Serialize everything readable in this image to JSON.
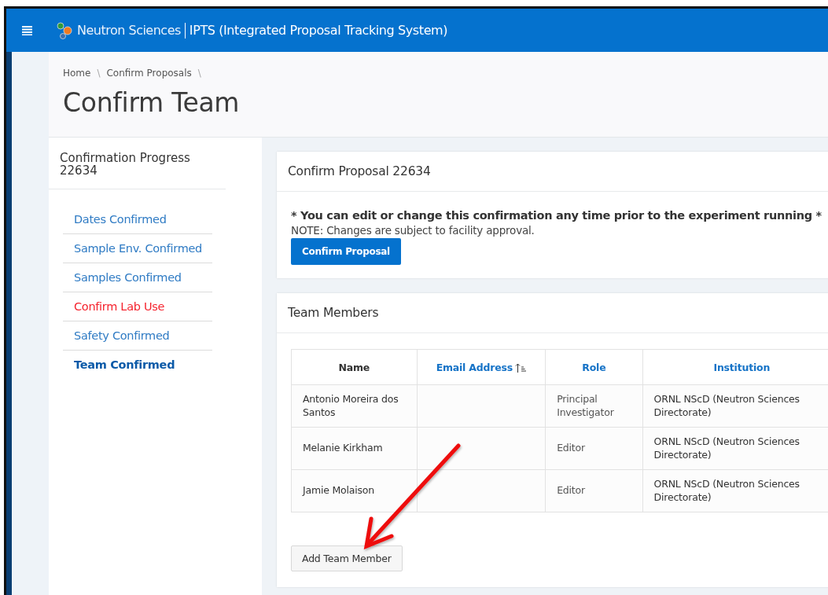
{
  "header": {
    "brand": "Neutron Sciences",
    "app_title": "IPTS (Integrated Proposal Tracking System)"
  },
  "breadcrumb": [
    {
      "label": "Home",
      "separator": "\\"
    },
    {
      "label": "Confirm Proposals",
      "separator": "\\"
    }
  ],
  "page_title": "Confirm Team",
  "sidebar": {
    "title": "Confirmation Progress 22634",
    "items": [
      {
        "label": "Dates Confirmed",
        "kind": "confirmed",
        "selected": false
      },
      {
        "label": "Sample Env. Confirmed",
        "kind": "confirmed",
        "selected": false
      },
      {
        "label": "Samples Confirmed",
        "kind": "confirmed",
        "selected": false
      },
      {
        "label": "Confirm Lab Use",
        "kind": "pending",
        "selected": false
      },
      {
        "label": "Safety Confirmed",
        "kind": "confirmed",
        "selected": false
      },
      {
        "label": "Team Confirmed",
        "kind": "confirmed",
        "selected": true
      }
    ]
  },
  "confirm_card": {
    "title": "Confirm Proposal 22634",
    "notice": "* You can edit or change this confirmation any time prior to the experiment running *",
    "note": "NOTE: Changes are subject to facility approval.",
    "button": "Confirm Proposal"
  },
  "team_card": {
    "title": "Team Members",
    "table": {
      "columns": [
        {
          "label": "Name",
          "sortable": false,
          "sorted": false
        },
        {
          "label": "Email Address",
          "sortable": true,
          "sorted": true
        },
        {
          "label": "Role",
          "sortable": true,
          "sorted": false
        },
        {
          "label": "Institution",
          "sortable": true,
          "sorted": false
        }
      ],
      "rows": [
        [
          "Antonio Moreira dos Santos",
          "",
          "Principal Investigator",
          "ORNL NScD (Neutron Sciences Directorate)"
        ],
        [
          "Melanie Kirkham",
          "",
          "Editor",
          "ORNL NScD (Neutron Sciences Directorate)"
        ],
        [
          "Jamie Molaison",
          "",
          "Editor",
          "ORNL NScD (Neutron Sciences Directorate)"
        ]
      ]
    },
    "button": "Add Team Member"
  }
}
